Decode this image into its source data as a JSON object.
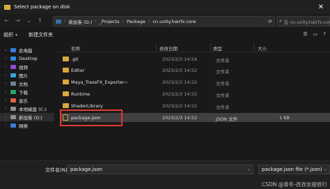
{
  "window": {
    "title": "Select package on disk",
    "close": "✕"
  },
  "address": {
    "crumbs": [
      "新加卷 (D:)",
      "_Projects",
      "Package",
      "cn.unity.hairfx.core"
    ],
    "separator": "›",
    "search_placeholder": "在 cn.unity.hairfx.core"
  },
  "toolbar": {
    "organize": "组织",
    "new_folder": "新建文件夹"
  },
  "sidebar": {
    "items": [
      {
        "label": "此电脑",
        "color": "#3a7bd5",
        "chev": "⌄"
      },
      {
        "label": "Desktop",
        "color": "#2f89e0",
        "chev": "›"
      },
      {
        "label": "视频",
        "color": "#8a4fd0",
        "chev": "›"
      },
      {
        "label": "图片",
        "color": "#3aa0d8",
        "chev": "›"
      },
      {
        "label": "文档",
        "color": "#6f7f8f",
        "chev": "›"
      },
      {
        "label": "下载",
        "color": "#2aa36a",
        "chev": "›"
      },
      {
        "label": "音乐",
        "color": "#e0604a",
        "chev": "›"
      },
      {
        "label": "本地磁盘 (C:)",
        "color": "#8e8e8e",
        "chev": "›"
      },
      {
        "label": "新加卷 (D:)",
        "color": "#8e8e8e",
        "chev": "›"
      },
      {
        "label": "网络",
        "color": "#3a7bd5",
        "chev": "›"
      }
    ]
  },
  "columns": {
    "name": "名称",
    "date": "修改日期",
    "type": "类型",
    "size": "大小"
  },
  "files": [
    {
      "name": ".git",
      "date": "2023/2/3 14:54",
      "type": "文件夹",
      "size": "",
      "kind": "folder"
    },
    {
      "name": "Editor",
      "date": "2023/2/3 14:52",
      "type": "文件夹",
      "size": "",
      "kind": "folder"
    },
    {
      "name": "Maya_TressFX_Exporter~",
      "date": "2023/2/3 14:52",
      "type": "文件夹",
      "size": "",
      "kind": "folder"
    },
    {
      "name": "Runtime",
      "date": "2023/2/3 14:52",
      "type": "文件夹",
      "size": "",
      "kind": "folder"
    },
    {
      "name": "ShaderLibrary",
      "date": "2023/2/3 14:52",
      "type": "文件夹",
      "size": "",
      "kind": "folder"
    },
    {
      "name": "package.json",
      "date": "2023/2/3 14:52",
      "type": "JSON 文件",
      "size": "1 KB",
      "kind": "file"
    }
  ],
  "footer": {
    "filename_label": "文件名(N):",
    "filename_value": "package.json",
    "filter_value": "package.json file (*.json)",
    "watermark": "CSDN @青冬-孜孜长驱修行"
  }
}
